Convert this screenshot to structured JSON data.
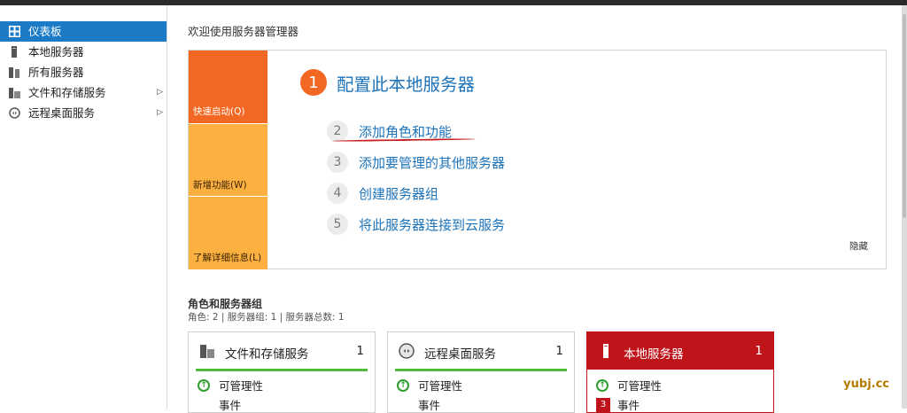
{
  "sidebar": {
    "items": [
      {
        "label": "仪表板",
        "icon": "dashboard-icon",
        "active": true
      },
      {
        "label": "本地服务器",
        "icon": "server-icon"
      },
      {
        "label": "所有服务器",
        "icon": "servers-icon"
      },
      {
        "label": "文件和存储服务",
        "icon": "storage-icon",
        "expand": "▷"
      },
      {
        "label": "远程桌面服务",
        "icon": "remote-desktop-icon",
        "expand": "▷"
      }
    ]
  },
  "welcome": {
    "title": "欢迎使用服务器管理器",
    "tiles": [
      "快速启动(Q)",
      "新增功能(W)",
      "了解详细信息(L)"
    ],
    "steps": [
      {
        "num": "1",
        "label": "配置此本地服务器"
      },
      {
        "num": "2",
        "label": "添加角色和功能"
      },
      {
        "num": "3",
        "label": "添加要管理的其他服务器"
      },
      {
        "num": "4",
        "label": "创建服务器组"
      },
      {
        "num": "5",
        "label": "将此服务器连接到云服务"
      }
    ],
    "hide_label": "隐藏"
  },
  "roles": {
    "title": "角色和服务器组",
    "subtitle": "角色: 2 | 服务器组: 1 | 服务器总数: 1",
    "cards": [
      {
        "title": "文件和存储服务",
        "count": "1",
        "row1": "可管理性",
        "row2": "事件"
      },
      {
        "title": "远程桌面服务",
        "count": "1",
        "row1": "可管理性",
        "row2": "事件"
      },
      {
        "title": "本地服务器",
        "count": "1",
        "row1": "可管理性",
        "row2": "事件",
        "badge": "3"
      }
    ]
  },
  "watermark": "yubj.cc",
  "colors": {
    "accent_blue": "#1d73b9",
    "active_blue": "#1c7bc6",
    "orange": "#f26722",
    "light_orange": "#fbb040",
    "alert_red": "#c0141b",
    "ok_green": "#4dbd3b"
  }
}
